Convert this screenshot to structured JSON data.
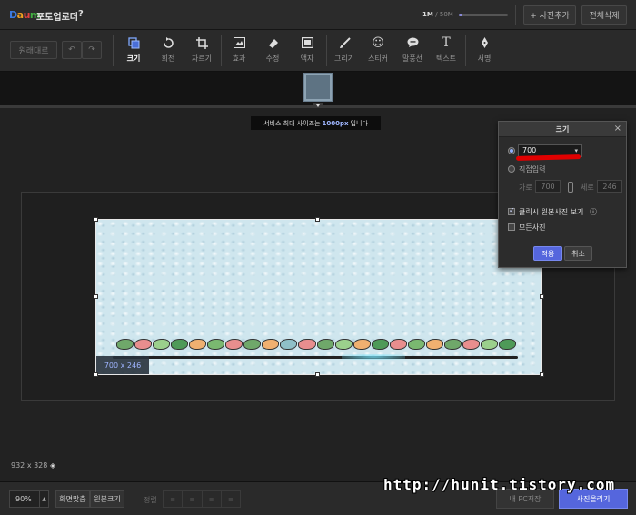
{
  "app": {
    "logo_text": "Daum",
    "title": "포토업로더",
    "help": "?"
  },
  "storage": {
    "used": "1M",
    "total": "/ 50M",
    "fraction": 0.02
  },
  "header_buttons": {
    "add_photo": "+ 사진추가",
    "delete_all": "전체삭제"
  },
  "toolbar": {
    "original": "원래대로",
    "undo": "↶",
    "redo": "↷",
    "tools": [
      {
        "label": "크기",
        "icon": "resize-icon"
      },
      {
        "label": "회전",
        "icon": "rotate-icon"
      },
      {
        "label": "자르기",
        "icon": "crop-icon"
      },
      {
        "label": "효과",
        "icon": "effect-icon"
      },
      {
        "label": "수정",
        "icon": "eraser-icon"
      },
      {
        "label": "액자",
        "icon": "frame-icon"
      },
      {
        "label": "그리기",
        "icon": "brush-icon"
      },
      {
        "label": "스티커",
        "icon": "smiley-icon"
      },
      {
        "label": "말풍선",
        "icon": "speech-bubble-icon"
      },
      {
        "label": "텍스트",
        "icon": "text-icon"
      },
      {
        "label": "서명",
        "icon": "pen-nib-icon"
      }
    ]
  },
  "notice": {
    "before": "서비스 최대 사이즈는",
    "value": "1000px",
    "after": "입니다"
  },
  "canvas": {
    "image_size_tag": "700 x 246",
    "original_dims": "932 x 328"
  },
  "size_panel": {
    "title": "크기",
    "close": "×",
    "preset_value": "700",
    "direct_input_label": "직접입력",
    "width_label": "가로",
    "width_value": "700",
    "height_label": "세로",
    "height_value": "246",
    "click_original_label": "클릭시 원본사진 보기",
    "click_original_checked": true,
    "all_photos_label": "모든사진",
    "all_photos_checked": false,
    "apply": "적용",
    "cancel": "취소"
  },
  "bottom": {
    "zoom": "90%",
    "fit_screen": "화면맞춤",
    "original_size": "원본크기",
    "align_label": "정렬",
    "save_pc": "내 PC저장",
    "upload": "사진올리기"
  },
  "watermark": "http://hunit.tistory.com",
  "colors": {
    "accent": "#5566dd",
    "highlight": "#e00000"
  }
}
